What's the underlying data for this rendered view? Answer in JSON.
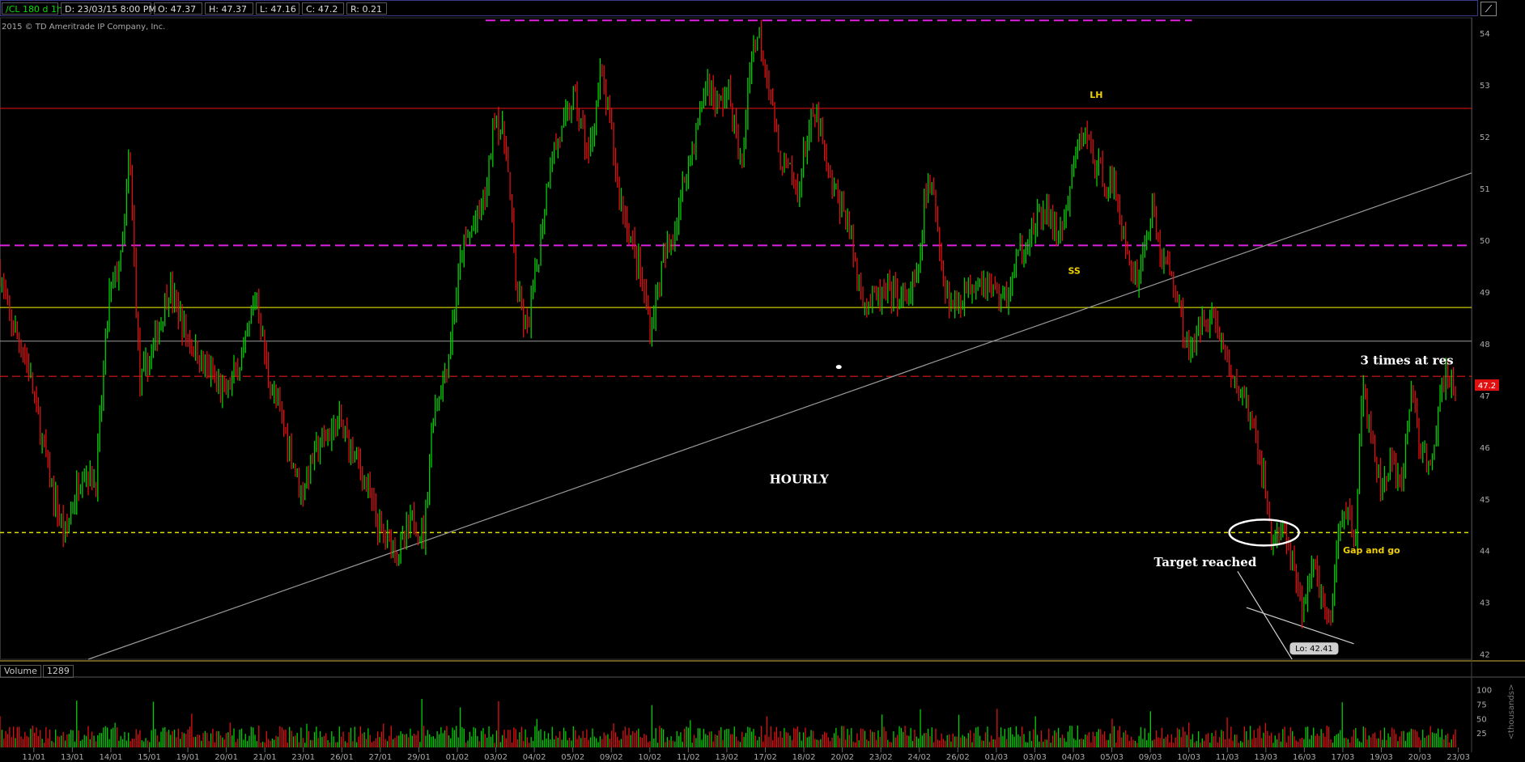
{
  "header": {
    "symbol": "/CL 180 d 1h",
    "date": "D: 23/03/15 8:00 PM",
    "open": "O: 47.37",
    "high": "H: 47.37",
    "low": "L: 47.16",
    "close": "C: 47.2",
    "range": "R: 0.21"
  },
  "copyright": "2015 © TD Ameritrade IP Company, Inc.",
  "volume_panel": {
    "label": "Volume",
    "value": "1289",
    "unit_label": "<thousands>"
  },
  "colors": {
    "up": "#00d000",
    "down": "#e01010",
    "magenta": "#e020e0",
    "yellow": "#c8c800",
    "grid": "#2a2a2a"
  },
  "chart_data": {
    "type": "candlestick",
    "price_range": [
      41.9,
      54.3
    ],
    "y_ticks": [
      "54",
      "53",
      "52",
      "51",
      "50",
      "49",
      "48",
      "47",
      "46",
      "45",
      "44",
      "43",
      "42"
    ],
    "x_ticks": [
      "11/01",
      "13/01",
      "14/01",
      "15/01",
      "19/01",
      "20/01",
      "21/01",
      "23/01",
      "26/01",
      "27/01",
      "29/01",
      "01/02",
      "03/02",
      "04/02",
      "05/02",
      "09/02",
      "10/02",
      "11/02",
      "13/02",
      "17/02",
      "18/02",
      "20/02",
      "23/02",
      "24/02",
      "26/02",
      "01/03",
      "03/03",
      "04/03",
      "05/03",
      "09/03",
      "10/03",
      "11/03",
      "13/03",
      "16/03",
      "17/03",
      "19/03",
      "20/03",
      "23/03"
    ],
    "last_price_label": "47.2",
    "low_label": "Lo: 42.41",
    "price_path": [
      [
        0,
        49.4
      ],
      [
        0.5,
        48.6
      ],
      [
        1.8,
        47.7
      ],
      [
        3.5,
        45.2
      ],
      [
        4.4,
        44.3
      ],
      [
        5.6,
        45.6
      ],
      [
        6.5,
        45.3
      ],
      [
        7.4,
        48.9
      ],
      [
        8.3,
        49.7
      ],
      [
        8.8,
        51.7
      ],
      [
        9.5,
        47.2
      ],
      [
        10.4,
        47.9
      ],
      [
        11.5,
        49.1
      ],
      [
        12.6,
        48.2
      ],
      [
        13.8,
        47.6
      ],
      [
        15.3,
        47.0
      ],
      [
        16.6,
        47.8
      ],
      [
        17.4,
        49.0
      ],
      [
        18.2,
        47.4
      ],
      [
        19.5,
        46.2
      ],
      [
        20.5,
        45.1
      ],
      [
        21.4,
        45.9
      ],
      [
        23.0,
        46.5
      ],
      [
        24.5,
        45.6
      ],
      [
        25.8,
        44.4
      ],
      [
        27.2,
        44.0
      ],
      [
        28.0,
        44.6
      ],
      [
        28.8,
        44.3
      ],
      [
        29.4,
        46.6
      ],
      [
        30.4,
        47.6
      ],
      [
        31.4,
        49.8
      ],
      [
        32.4,
        50.4
      ],
      [
        33.1,
        51.0
      ],
      [
        33.6,
        52.5
      ],
      [
        34.4,
        51.8
      ],
      [
        35.1,
        49.0
      ],
      [
        35.8,
        48.2
      ],
      [
        36.6,
        49.7
      ],
      [
        37.4,
        51.6
      ],
      [
        38.2,
        52.1
      ],
      [
        39.0,
        52.8
      ],
      [
        40.0,
        51.6
      ],
      [
        40.8,
        53.2
      ],
      [
        41.5,
        52.2
      ],
      [
        42.0,
        51.0
      ],
      [
        42.7,
        50.2
      ],
      [
        43.4,
        49.5
      ],
      [
        44.2,
        48.3
      ],
      [
        45.0,
        49.5
      ],
      [
        45.8,
        50.2
      ],
      [
        46.6,
        51.3
      ],
      [
        47.4,
        52.2
      ],
      [
        48.0,
        53.1
      ],
      [
        48.8,
        52.6
      ],
      [
        49.5,
        52.9
      ],
      [
        50.4,
        51.3
      ],
      [
        51.0,
        53.6
      ],
      [
        51.6,
        54.0
      ],
      [
        52.3,
        53.0
      ],
      [
        52.9,
        51.6
      ],
      [
        53.5,
        51.4
      ],
      [
        54.2,
        50.9
      ],
      [
        54.9,
        52.1
      ],
      [
        55.5,
        52.4
      ],
      [
        56.3,
        51.2
      ],
      [
        56.9,
        50.8
      ],
      [
        57.6,
        50.4
      ],
      [
        58.3,
        49.2
      ],
      [
        58.9,
        48.8
      ],
      [
        59.8,
        48.9
      ],
      [
        60.6,
        49.0
      ],
      [
        61.5,
        48.8
      ],
      [
        62.4,
        49.3
      ],
      [
        62.9,
        51.0
      ],
      [
        63.5,
        50.8
      ],
      [
        64.1,
        49.3
      ],
      [
        64.7,
        48.7
      ],
      [
        65.5,
        49.0
      ],
      [
        66.6,
        49.3
      ],
      [
        67.6,
        49.0
      ],
      [
        68.4,
        48.9
      ],
      [
        69.2,
        49.7
      ],
      [
        70.2,
        50.2
      ],
      [
        71.0,
        50.6
      ],
      [
        71.8,
        50.1
      ],
      [
        72.5,
        50.5
      ],
      [
        73.1,
        51.7
      ],
      [
        73.8,
        52.1
      ],
      [
        74.4,
        51.4
      ],
      [
        75.1,
        51.2
      ],
      [
        75.9,
        50.9
      ],
      [
        76.5,
        49.7
      ],
      [
        77.3,
        49.3
      ],
      [
        78.3,
        50.6
      ],
      [
        79.0,
        49.6
      ],
      [
        79.7,
        49.3
      ],
      [
        80.4,
        48.3
      ],
      [
        81.0,
        47.8
      ],
      [
        81.8,
        48.6
      ],
      [
        82.5,
        48.5
      ],
      [
        83.2,
        47.9
      ],
      [
        83.8,
        47.2
      ],
      [
        84.6,
        47.0
      ],
      [
        85.3,
        46.1
      ],
      [
        85.8,
        45.6
      ],
      [
        86.4,
        44.2
      ],
      [
        87.2,
        44.4
      ],
      [
        87.9,
        43.6
      ],
      [
        88.5,
        42.8
      ],
      [
        89.1,
        43.7
      ],
      [
        89.8,
        43.2
      ],
      [
        90.4,
        42.4
      ],
      [
        90.9,
        44.3
      ],
      [
        91.6,
        44.9
      ],
      [
        92.1,
        44.2
      ],
      [
        92.6,
        47.2
      ],
      [
        93.2,
        46.1
      ],
      [
        93.8,
        45.2
      ],
      [
        94.5,
        45.7
      ],
      [
        95.2,
        45.1
      ],
      [
        95.9,
        47.2
      ],
      [
        96.5,
        46.0
      ],
      [
        97.2,
        45.5
      ],
      [
        97.9,
        47.0
      ],
      [
        98.4,
        47.4
      ],
      [
        98.9,
        47.2
      ]
    ],
    "horizontal_levels": [
      {
        "price": 54.25,
        "style": "magenta-dashed",
        "x_from": 33,
        "x_to": 81
      },
      {
        "price": 52.55,
        "style": "red-solid"
      },
      {
        "price": 49.9,
        "style": "magenta-dashed"
      },
      {
        "price": 48.7,
        "style": "yellow-solid"
      },
      {
        "price": 48.05,
        "style": "grey-solid"
      },
      {
        "price": 47.37,
        "style": "red-dashed"
      },
      {
        "price": 44.35,
        "style": "yellow-dashed"
      }
    ],
    "trendline": {
      "from": [
        6.0,
        41.9
      ],
      "to": [
        100,
        51.3
      ]
    },
    "annotations": [
      {
        "text": "LH",
        "x": 74.5,
        "price": 52.75,
        "color": "#f0d000",
        "size": 11
      },
      {
        "text": "SS",
        "x": 73.0,
        "price": 49.35,
        "color": "#f0d000",
        "size": 11
      },
      {
        "text": "HOURLY",
        "x": 54.3,
        "price": 45.3,
        "color": "#ffffff",
        "size": 15
      },
      {
        "text": "3 times at res",
        "x": 95.6,
        "price": 47.6,
        "color": "#ffffff",
        "size": 15
      },
      {
        "text": "Target reached",
        "x": 81.9,
        "price": 43.7,
        "color": "#ffffff",
        "size": 15
      },
      {
        "text": "Gap and go",
        "x": 93.2,
        "price": 43.95,
        "color": "#f0d000",
        "size": 11
      }
    ]
  }
}
